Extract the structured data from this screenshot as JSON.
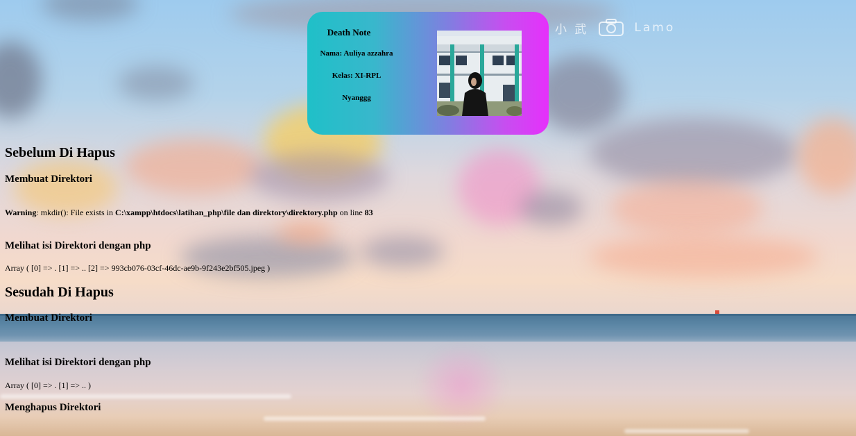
{
  "card": {
    "title": "Death Note",
    "name_line": "Nama: Auliya azzahra",
    "class_line": "Kelas: XI-RPL",
    "note_line": "Nyanggg"
  },
  "watermark": {
    "left_text": "小 武",
    "right_text": "Lamo",
    "icon": "camera-icon"
  },
  "sections": {
    "before_heading": "Sebelum Di Hapus",
    "create_dir_1": "Membuat Direktori",
    "warning": {
      "label": "Warning",
      "message": ": mkdir(): File exists in ",
      "path": "C:\\xampp\\htdocs\\latihan_php\\file dan direktory\\direktory.php",
      "on_line": " on line ",
      "line_number": "83"
    },
    "view_dir_1": "Melihat isi Direktori dengan php",
    "array_1": "Array ( [0] => . [1] => .. [2] => 993cb076-03cf-46dc-ae9b-9f243e2bf505.jpeg )",
    "after_heading": "Sesudah Di Hapus",
    "create_dir_2": "Membuat Direktori",
    "view_dir_2": "Melihat isi Direktori dengan php",
    "array_2": "Array ( [0] => . [1] => .. )",
    "delete_dir": "Menghapus Direktori"
  },
  "colors": {
    "card_gradient_start": "#1fc0c8",
    "card_gradient_end": "#e630fb"
  }
}
